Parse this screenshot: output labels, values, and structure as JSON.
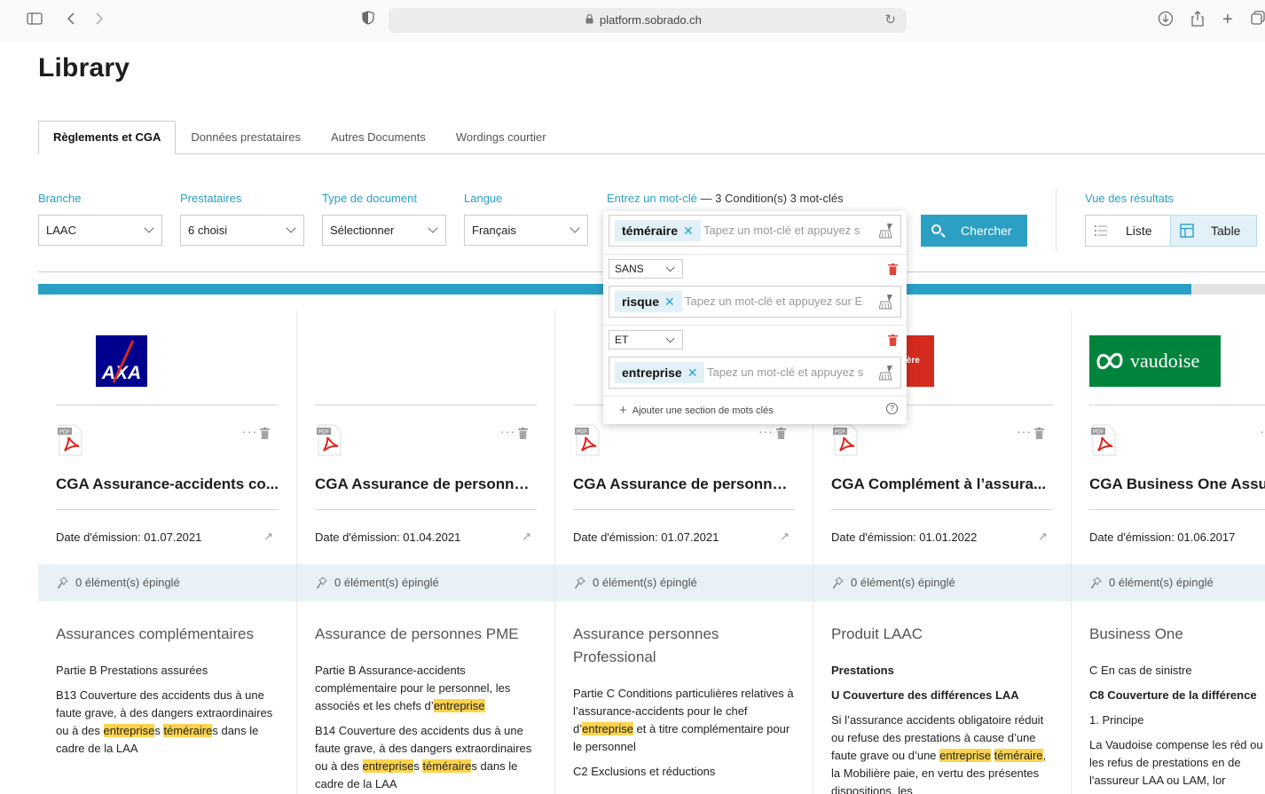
{
  "browser": {
    "url": "platform.sobrado.ch"
  },
  "page": {
    "title": "Library"
  },
  "tabs": [
    {
      "label": "Règlements et CGA",
      "active": true
    },
    {
      "label": "Données prestataires",
      "active": false
    },
    {
      "label": "Autres Documents",
      "active": false
    },
    {
      "label": "Wordings courtier",
      "active": false
    }
  ],
  "filters": {
    "branche": {
      "label": "Branche",
      "value": "LAAC"
    },
    "prestataires": {
      "label": "Prestataires",
      "value": "6 choisi"
    },
    "type": {
      "label": "Type de document",
      "value": "Sélectionner"
    },
    "langue": {
      "label": "Langue",
      "value": "Français"
    },
    "keyword": {
      "label": "Entrez un mot-clé",
      "summary": "— 3 Condition(s) 3 mot-clés"
    },
    "search_button": "Chercher"
  },
  "view": {
    "label": "Vue des résultats",
    "list": "Liste",
    "table": "Table",
    "selected": "Table"
  },
  "progress": {
    "fraction": 0.94
  },
  "popover": {
    "sections": [
      {
        "operator": null,
        "chip": "téméraire",
        "placeholder": "Tapez un mot-clé et appuyez s"
      },
      {
        "operator": "SANS",
        "chip": "risque",
        "placeholder": "Tapez un mot-clé et appuyez sur E"
      },
      {
        "operator": "ET",
        "chip": "entreprise",
        "placeholder": "Tapez un mot-clé et appuyez s"
      }
    ],
    "add_section": "Ajouter une section de mots clés",
    "help": "?"
  },
  "cards": [
    {
      "logo": "AXA",
      "title": "CGA Assurance-accidents co...",
      "date": "Date d'émission: 01.07.2021",
      "pinned": "0 élément(s) épinglé",
      "heading": "Assurances complémentaires",
      "sub1": "Partie B Prestations assurées",
      "body": "B13 Couverture des accidents dus à une faute grave, à des dangers extraordinaires ou à des entreprises téméraires dans le cadre de la LAA"
    },
    {
      "logo": "",
      "title": "CGA Assurance de personnes...",
      "date": "Date d'émission: 01.04.2021",
      "pinned": "0 élément(s) épinglé",
      "heading": "Assurance de personnes PME",
      "sub1": "Partie B Assurance-accidents complémentaire pour le personnel, les associés et les chefs d’entreprise",
      "body": "B14 Couverture des accidents dus à une faute grave, à des dangers extraordinaires ou à des entreprises téméraires dans le cadre de la LAA"
    },
    {
      "logo": "",
      "title": "CGA Assurance de personnes...",
      "date": "Date d'émission: 01.07.2021",
      "pinned": "0 élément(s) épinglé",
      "heading": "Assurance personnes Professional",
      "sub1": "Partie C Conditions particulières relatives à l’assurance-accidents pour le chef d’entreprise et à titre complémentaire pour le personnel",
      "body": "C2 Exclusions et réductions"
    },
    {
      "logo": "ière",
      "title": "CGA Complément à l’assura...",
      "date": "Date d'émission: 01.01.2022",
      "pinned": "0 élément(s) épinglé",
      "heading": "Produit LAAC",
      "sub1": "Prestations",
      "sub2": "U Couverture des différences LAA",
      "body": "Si l’assurance accidents obligatoire réduit ou refuse des prestations à cause d’une faute grave ou d’une entreprise téméraire, la Mobilière paie, en vertu des présentes dispositions, les"
    },
    {
      "logo": "vaudoise",
      "title": "CGA Business One Assurance",
      "date": "Date d'émission: 01.06.2017",
      "pinned": "0 élément(s) épinglé",
      "heading": "Business One",
      "sub1": "C En cas de sinistre",
      "sub2": "C8 Couverture de la différence",
      "sub3": "1. Principe",
      "body": "La Vaudoise compense les réd ou les refus de prestations en de l'assureur LAA ou LAM, lor"
    }
  ],
  "colors": {
    "accent": "#2ba0c4",
    "highlight": "#fcd34d",
    "axa_blue": "#00008f",
    "vaudoise_green": "#00843d",
    "mobiliere_red": "#d52b1e"
  }
}
